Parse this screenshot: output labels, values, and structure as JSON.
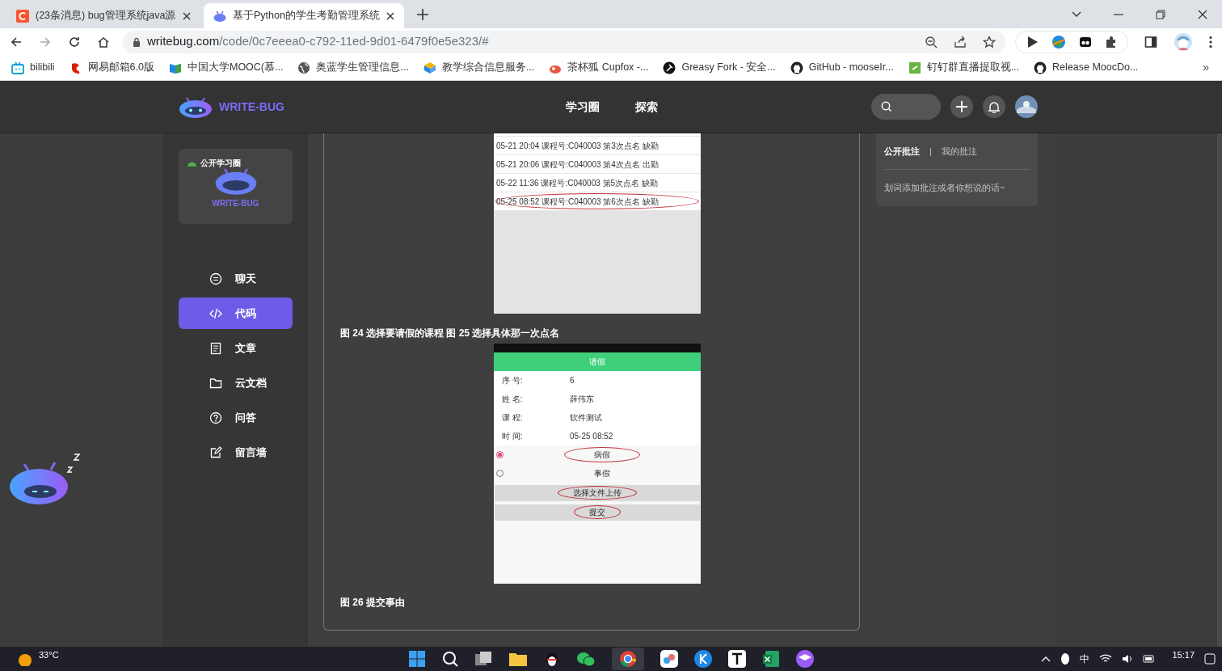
{
  "browser": {
    "tabs": [
      {
        "title": "(23条消息) bug管理系统java源",
        "selected": false,
        "kind": "csdn"
      },
      {
        "title": "基于Python的学生考勤管理系统",
        "selected": true,
        "kind": "writebug"
      }
    ],
    "url": {
      "host": "writebug.com",
      "path": "/code/0c7eeea0-c792-11ed-9d01-6479f0e5e323/#"
    },
    "bookmarks": [
      {
        "label": "bilibili",
        "kind": "tv"
      },
      {
        "label": "网易邮箱6.0版",
        "kind": "mail"
      },
      {
        "label": "中国大学MOOC(慕...",
        "kind": "book"
      },
      {
        "label": "奥蓝学生管理信息...",
        "kind": "globe"
      },
      {
        "label": "教学综合信息服务...",
        "kind": "cube"
      },
      {
        "label": "茶杯狐 Cupfox -...",
        "kind": "fox"
      },
      {
        "label": "Greasy Fork - 安全...",
        "kind": "fork"
      },
      {
        "label": "GitHub - mooseIr...",
        "kind": "github"
      },
      {
        "label": "钉钉群直播提取视...",
        "kind": "green"
      },
      {
        "label": "Release MoocDo...",
        "kind": "github"
      }
    ],
    "bookmarks_more": "»"
  },
  "site": {
    "logo_text": "WRITE-BUG",
    "nav": [
      {
        "label": "学习圈"
      },
      {
        "label": "探索"
      }
    ]
  },
  "sidebar": {
    "badge": "公开学习圈",
    "card_logo_text": "WRITE-BUG",
    "items": [
      {
        "label": "聊天",
        "kind": "chat",
        "selected": false
      },
      {
        "label": "代码",
        "kind": "code",
        "selected": true
      },
      {
        "label": "文章",
        "kind": "article",
        "selected": false
      },
      {
        "label": "云文档",
        "kind": "folder",
        "selected": false
      },
      {
        "label": "问答",
        "kind": "question",
        "selected": false
      },
      {
        "label": "留言墙",
        "kind": "edit",
        "selected": false
      }
    ]
  },
  "article": {
    "screenshot_1": {
      "rows": [
        {
          "text": "05-21 20:04 课程号:C040003 第3次点名 缺勤",
          "circled": false
        },
        {
          "text": "05-21 20:06 课程号:C040003 第4次点名 出勤",
          "circled": false
        },
        {
          "text": "05-22 11:36 课程号:C040003 第5次点名 缺勤",
          "circled": false
        },
        {
          "text": "05-25 08:52 课程号:C040003 第6次点名 缺勤",
          "circled": true
        }
      ]
    },
    "caption_1": "图 24 选择要请假的课程 图 25 选择具体那一次点名",
    "screenshot_2": {
      "title": "请假",
      "fields": [
        {
          "label": "序 号:",
          "value": "6"
        },
        {
          "label": "姓 名:",
          "value": "薛伟东"
        },
        {
          "label": "课 程:",
          "value": "软件测试"
        },
        {
          "label": "时 间:",
          "value": "05-25 08:52"
        }
      ],
      "options": [
        {
          "label": "病假",
          "selected": true,
          "circled": true
        },
        {
          "label": "事假",
          "selected": false,
          "circled": false
        }
      ],
      "buttons": [
        {
          "label": "选择文件上传",
          "circled": true
        },
        {
          "label": "提交",
          "circled": true
        }
      ]
    },
    "caption_2": "图 26 提交事由"
  },
  "annotations": {
    "tabs": [
      {
        "label": "公开批注",
        "selected": true
      },
      {
        "label": "我的批注",
        "selected": false
      }
    ],
    "separator": "|",
    "placeholder": "划词添加批注或者你想说的话~"
  },
  "taskbar": {
    "temperature": "33°C",
    "ime": "中",
    "time": "15:17"
  }
}
